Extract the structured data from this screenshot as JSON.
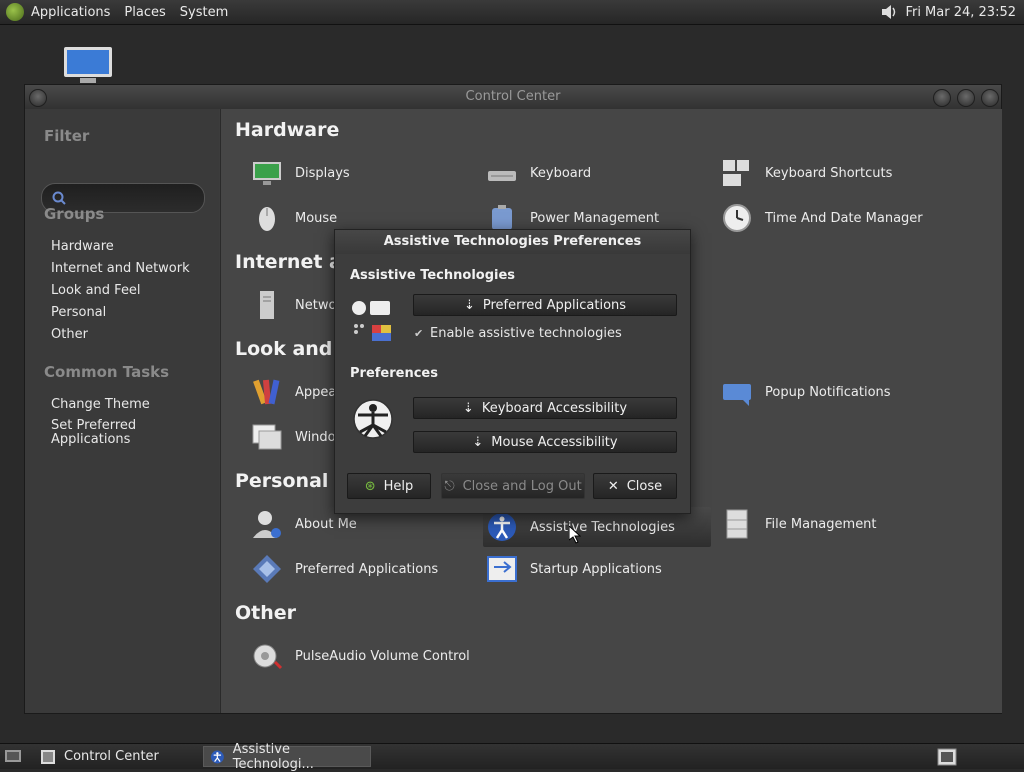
{
  "top_panel": {
    "menus": [
      "Applications",
      "Places",
      "System"
    ],
    "clock": "Fri Mar 24, 23:52"
  },
  "window": {
    "title": "Control Center",
    "sidebar": {
      "filter_label": "Filter",
      "groups_label": "Groups",
      "groups": [
        "Hardware",
        "Internet and Network",
        "Look and Feel",
        "Personal",
        "Other"
      ],
      "common_tasks_label": "Common Tasks",
      "tasks": [
        "Change Theme",
        "Set Preferred\nApplications"
      ]
    },
    "sections": {
      "hardware": "Hardware",
      "internet": "Internet and",
      "look": "Look and F",
      "personal": "Personal",
      "other": "Other"
    },
    "items": {
      "displays": "Displays",
      "keyboard": "Keyboard",
      "keyboard_shortcuts": "Keyboard Shortcuts",
      "mouse": "Mouse",
      "power_management": "Power Management",
      "time_date": "Time And Date Manager",
      "network": "Netwo",
      "appearance": "Appear",
      "popup_notifications": "Popup Notifications",
      "windows": "Window",
      "about_me": "About Me",
      "assistive": "Assistive Technologies",
      "file_management": "File Management",
      "preferred_apps": "Preferred Applications",
      "startup_apps": "Startup Applications",
      "pulseaudio": "PulseAudio Volume Control"
    }
  },
  "dialog": {
    "title": "Assistive Technologies Preferences",
    "section1": "Assistive Technologies",
    "preferred_button": "Preferred Applications",
    "enable_label": "Enable assistive technologies",
    "section2": "Preferences",
    "keyboard_button": "Keyboard Accessibility",
    "mouse_button": "Mouse Accessibility",
    "help_button": "Help",
    "logout_button": "Close and Log Out",
    "close_button": "Close"
  },
  "taskbar": {
    "tasks": [
      "Control Center",
      "Assistive Technologi..."
    ]
  }
}
